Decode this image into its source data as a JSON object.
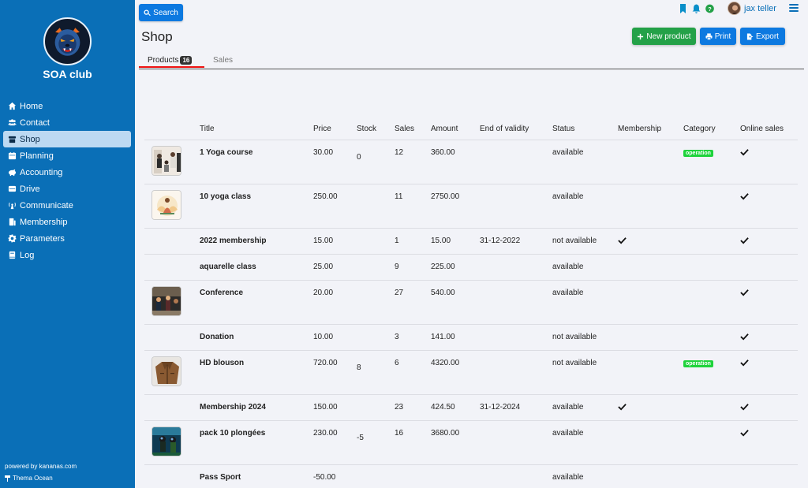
{
  "sidebar": {
    "club_name": "SOA club",
    "items": [
      {
        "label": "Home",
        "icon": "home-icon"
      },
      {
        "label": "Contact",
        "icon": "users-icon"
      },
      {
        "label": "Shop",
        "icon": "shop-icon",
        "active": true
      },
      {
        "label": "Planning",
        "icon": "calendar-icon"
      },
      {
        "label": "Accounting",
        "icon": "piggy-bank-icon"
      },
      {
        "label": "Drive",
        "icon": "drive-icon"
      },
      {
        "label": "Communicate",
        "icon": "broadcast-icon"
      },
      {
        "label": "Membership",
        "icon": "id-badge-icon"
      },
      {
        "label": "Parameters",
        "icon": "gear-icon"
      },
      {
        "label": "Log",
        "icon": "book-icon"
      }
    ],
    "powered_by": "powered by kananas.com",
    "theme": "Thema Ocean"
  },
  "header": {
    "search_label": "Search",
    "user_name": "jax teller"
  },
  "page": {
    "title": "Shop",
    "new_product_label": "New product",
    "print_label": "Print",
    "export_label": "Export"
  },
  "tabs": {
    "products_label": "Products",
    "products_count": "16",
    "sales_label": "Sales"
  },
  "table": {
    "columns": [
      "Title",
      "Price",
      "Stock",
      "Sales",
      "Amount",
      "End of validity",
      "Status",
      "Membership",
      "Category",
      "Online sales"
    ],
    "rows": [
      {
        "title": "1 Yoga course",
        "price": "30.00",
        "stock": "0",
        "sales": "12",
        "amount": "360.00",
        "end": "",
        "status": "available",
        "membership": false,
        "category": "operation",
        "online": true,
        "thumb": "yoga-group"
      },
      {
        "title": "10 yoga class",
        "price": "250.00",
        "stock": "",
        "sales": "11",
        "amount": "2750.00",
        "end": "",
        "status": "available",
        "membership": false,
        "category": "",
        "online": true,
        "thumb": "yoga-lotus"
      },
      {
        "title": "2022 membership",
        "price": "15.00",
        "stock": "",
        "sales": "1",
        "amount": "15.00",
        "end": "31-12-2022",
        "status": "not available",
        "membership": true,
        "category": "",
        "online": true,
        "thumb": ""
      },
      {
        "title": "aquarelle class",
        "price": "25.00",
        "stock": "",
        "sales": "9",
        "amount": "225.00",
        "end": "",
        "status": "available",
        "membership": false,
        "category": "",
        "online": false,
        "thumb": ""
      },
      {
        "title": "Conference",
        "price": "20.00",
        "stock": "",
        "sales": "27",
        "amount": "540.00",
        "end": "",
        "status": "available",
        "membership": false,
        "category": "",
        "online": true,
        "thumb": "conference"
      },
      {
        "title": "Donation",
        "price": "10.00",
        "stock": "",
        "sales": "3",
        "amount": "141.00",
        "end": "",
        "status": "not available",
        "membership": false,
        "category": "",
        "online": true,
        "thumb": ""
      },
      {
        "title": "HD blouson",
        "price": "720.00",
        "stock": "8",
        "sales": "6",
        "amount": "4320.00",
        "end": "",
        "status": "not available",
        "membership": false,
        "category": "operation",
        "online": true,
        "thumb": "jacket"
      },
      {
        "title": "Membership 2024",
        "price": "150.00",
        "stock": "",
        "sales": "23",
        "amount": "424.50",
        "end": "31-12-2024",
        "status": "available",
        "membership": true,
        "category": "",
        "online": true,
        "thumb": ""
      },
      {
        "title": "pack 10 plongées",
        "price": "230.00",
        "stock": "-5",
        "sales": "16",
        "amount": "3680.00",
        "end": "",
        "status": "available",
        "membership": false,
        "category": "",
        "online": true,
        "thumb": "diving"
      },
      {
        "title": "Pass Sport",
        "price": "-50.00",
        "stock": "",
        "sales": "",
        "amount": "",
        "end": "",
        "status": "available",
        "membership": false,
        "category": "",
        "online": false,
        "thumb": ""
      }
    ]
  },
  "colors": {
    "sidebar": "#0a6fb7",
    "primary": "#0d79e0",
    "success": "#24a148",
    "category_badge": "#1ed33b",
    "tab_underline": "#ee1111"
  }
}
